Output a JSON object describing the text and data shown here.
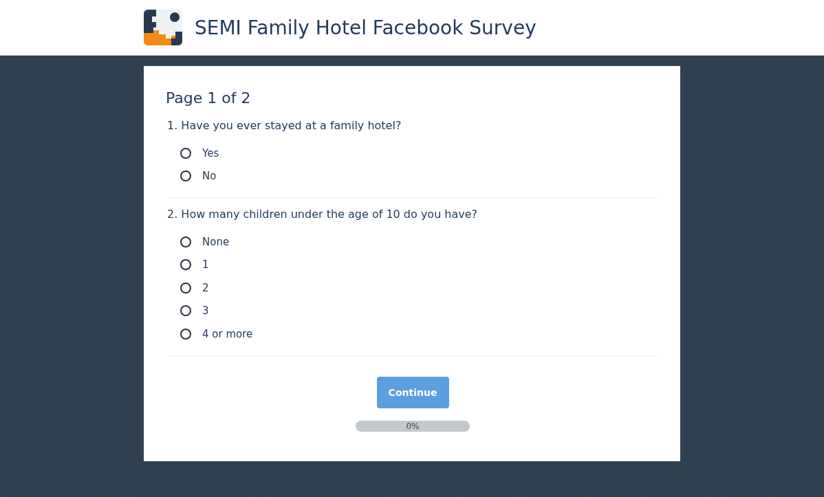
{
  "header": {
    "title": "SEMI Family Hotel Facebook Survey"
  },
  "page": {
    "heading": "Page 1 of 2"
  },
  "questions": [
    {
      "text": "1. Have you ever stayed at a family hotel?",
      "options": [
        {
          "label": "Yes",
          "selected": false
        },
        {
          "label": "No",
          "selected": false
        }
      ]
    },
    {
      "text": "2. How many children under the age of 10 do you have?",
      "options": [
        {
          "label": "None",
          "selected": false
        },
        {
          "label": "1",
          "selected": false
        },
        {
          "label": "2",
          "selected": false
        },
        {
          "label": "3",
          "selected": false
        },
        {
          "label": "4 or more",
          "selected": false
        }
      ]
    }
  ],
  "continue_button": {
    "label": "Continue"
  },
  "progress": {
    "level": 0,
    "reading": "0%"
  }
}
